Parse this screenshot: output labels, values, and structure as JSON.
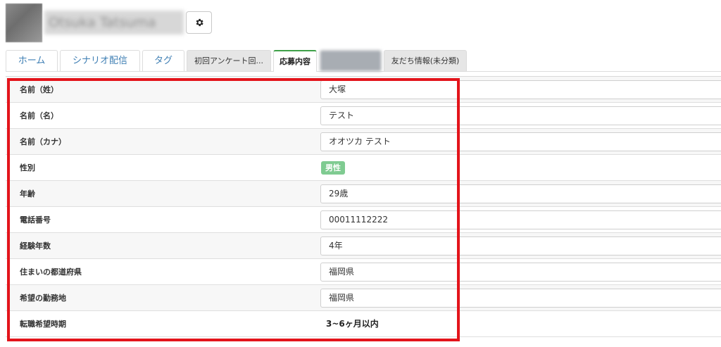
{
  "profile": {
    "name": "Otsuka Tatsuma",
    "settings_icon": "gear-icon"
  },
  "tabs": [
    {
      "label": "ホーム"
    },
    {
      "label": "シナリオ配信"
    },
    {
      "label": "タグ"
    },
    {
      "label": "初回アンケート回..."
    },
    {
      "label": "応募内容"
    },
    {
      "label": ""
    },
    {
      "label": "友だち情報(未分類)"
    }
  ],
  "form": {
    "rows": [
      {
        "label": "名前（姓）",
        "value": "大塚"
      },
      {
        "label": "名前（名）",
        "value": "テスト"
      },
      {
        "label": "名前（カナ）",
        "value": "オオツカ テスト"
      },
      {
        "label": "性別",
        "value": "男性"
      },
      {
        "label": "年齢",
        "value": "29歳"
      },
      {
        "label": "電話番号",
        "value": "00011112222"
      },
      {
        "label": "経験年数",
        "value": "4年"
      },
      {
        "label": "住まいの都道府県",
        "value": "福岡県"
      },
      {
        "label": "希望の勤務地",
        "value": "福岡県"
      },
      {
        "label": "転職希望時期",
        "value": "3~6ヶ月以内"
      }
    ]
  },
  "colors": {
    "highlight": "#e3141b",
    "active_tab_accent": "#3fa048",
    "gender_badge": "#7fcb91",
    "tab_link": "#3f7fb4"
  }
}
